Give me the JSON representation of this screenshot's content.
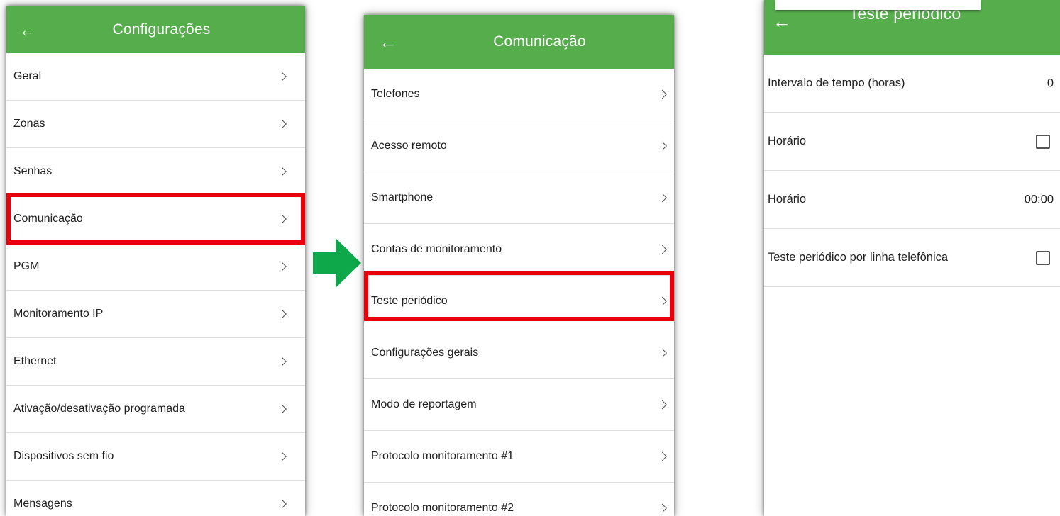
{
  "colors": {
    "appbar": "#56ad4c",
    "highlight": "#e8000b",
    "arrow": "#0ea84a"
  },
  "screens": [
    {
      "title": "Configurações",
      "back_icon": "arrow-left-icon",
      "items": [
        {
          "label": "Geral"
        },
        {
          "label": "Zonas"
        },
        {
          "label": "Senhas"
        },
        {
          "label": "Comunicação"
        },
        {
          "label": "PGM"
        },
        {
          "label": "Monitoramento IP"
        },
        {
          "label": "Ethernet"
        },
        {
          "label": "Ativação/desativação programada"
        },
        {
          "label": "Dispositivos sem fio"
        },
        {
          "label": "Mensagens"
        }
      ],
      "highlighted_item": "Comunicação"
    },
    {
      "title": "Comunicação",
      "back_icon": "arrow-left-icon",
      "items": [
        {
          "label": "Telefones"
        },
        {
          "label": "Acesso remoto"
        },
        {
          "label": "Smartphone"
        },
        {
          "label": "Contas de monitoramento"
        },
        {
          "label": "Teste periódico"
        },
        {
          "label": "Configurações gerais"
        },
        {
          "label": "Modo de reportagem"
        },
        {
          "label": "Protocolo monitoramento #1"
        },
        {
          "label": "Protocolo monitoramento #2"
        }
      ],
      "highlighted_item": "Teste periódico"
    },
    {
      "title": "Teste periódico",
      "back_icon": "arrow-left-icon",
      "items": [
        {
          "label": "Intervalo de tempo (horas)",
          "value": "0"
        },
        {
          "label": "Horário",
          "checked": false
        },
        {
          "label": "Horário",
          "value": "00:00"
        },
        {
          "label": "Teste periódico por linha telefônica",
          "checked": false
        }
      ]
    }
  ],
  "transition_arrow_icon": "arrow-right-icon"
}
